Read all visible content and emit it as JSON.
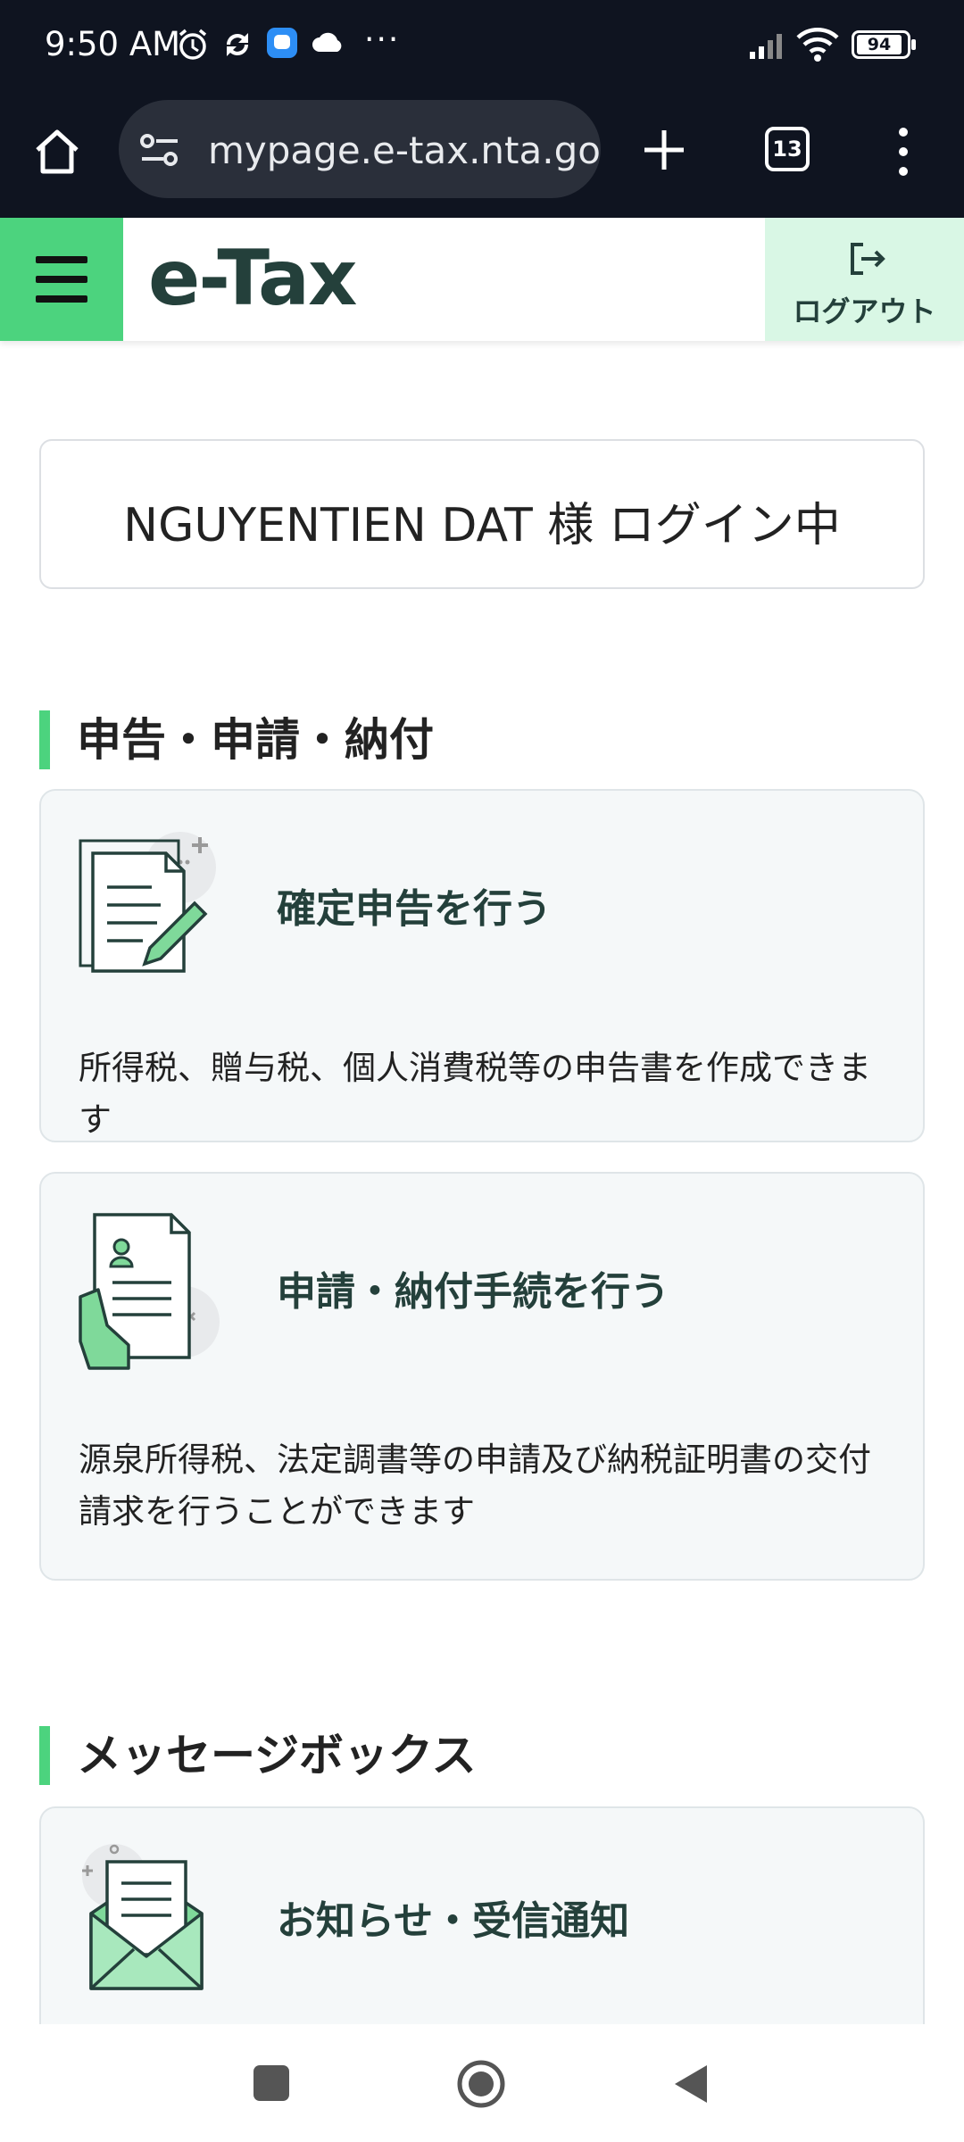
{
  "status_bar": {
    "time": "9:50 AM",
    "battery": "94",
    "more": "···"
  },
  "browser": {
    "url": "mypage.e-tax.nta.go.jp",
    "tab_count": "13"
  },
  "header": {
    "logo": "e-Tax",
    "logout_label": "ログアウト"
  },
  "login_status": "NGUYENTIEN DAT 様 ログイン中",
  "sections": {
    "filing": {
      "title": "申告・申請・納付",
      "cards": [
        {
          "title": "確定申告を行う",
          "description": "所得税、贈与税、個人消費税等の申告書を作成できます"
        },
        {
          "title": "申請・納付手続を行う",
          "description": "源泉所得税、法定調書等の申請及び納税証明書の交付請求を行うことができます"
        }
      ]
    },
    "messages": {
      "title": "メッセージボックス",
      "cards": [
        {
          "title": "お知らせ・受信通知"
        }
      ]
    }
  },
  "colors": {
    "accent": "#4cd37e",
    "brand_text": "#24403b",
    "card_bg": "#f5f8f9"
  }
}
